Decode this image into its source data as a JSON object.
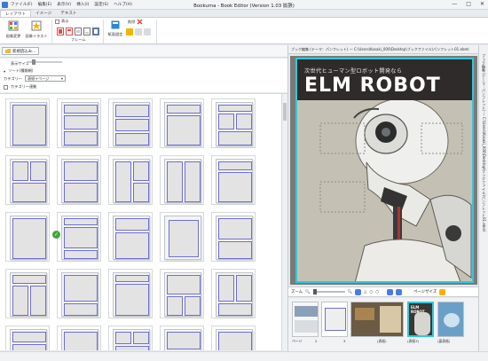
{
  "window": {
    "title": "Bookuma - Book Editor (Version 1.03 拡張)",
    "menu": [
      "ファイル(F)",
      "編集(E)",
      "表示(V)",
      "挿入(I)",
      "設定(S)",
      "ヘルプ(H)"
    ],
    "controls": [
      "—",
      "□",
      "✕"
    ]
  },
  "ribbon": {
    "tabs": [
      "レイアウト",
      "イメージ",
      "テキスト"
    ],
    "buttons": {
      "image_change": "画像変更",
      "image_illust": "画像イラスト",
      "frame_group": "フレーム",
      "show_check": "表示",
      "settings": "紙面設定",
      "delete": "削除"
    }
  },
  "left": {
    "new_read_button": "新規読込み...",
    "size_label": "表示サイズ",
    "sort_label": "ソート(種類順)",
    "category_label": "カテゴリー",
    "category_value": "表紙+ページ",
    "category_link": "カテゴリー連動"
  },
  "right": {
    "path": "ブック編集 (テーマ：パンフレット) — C:\\Users\\Kosaki_000\\Desktop\\ブックファイル\\パンフレット01.ebml",
    "page_subtitle": "次世代ヒューマン型ロボット開発なら",
    "page_title": "ELM ROBOT",
    "zoom_label": "ズーム",
    "page_label": "ページサイズ",
    "film": [
      {
        "label": "ページ",
        "num": "2"
      },
      {
        "label": "",
        "num": "3"
      },
      {
        "label": "(表紙)",
        "num": ""
      },
      {
        "label": "(表紙3)",
        "num": ""
      },
      {
        "label": "(裏表紙)",
        "num": ""
      }
    ],
    "film_cover_title": "ELM ROBOT",
    "side_vertical": "ブック編集 (テーマ：パンフレット) — C:\\Users\\Kosaki_000\\Desktop\\ブックファイル\\パンフレット01.ebml"
  },
  "colors": {
    "accent": "#35c6d8",
    "check": "#3aa935",
    "frame_line": "#6f6fd0",
    "cover_bg": "#2f2b2a"
  }
}
